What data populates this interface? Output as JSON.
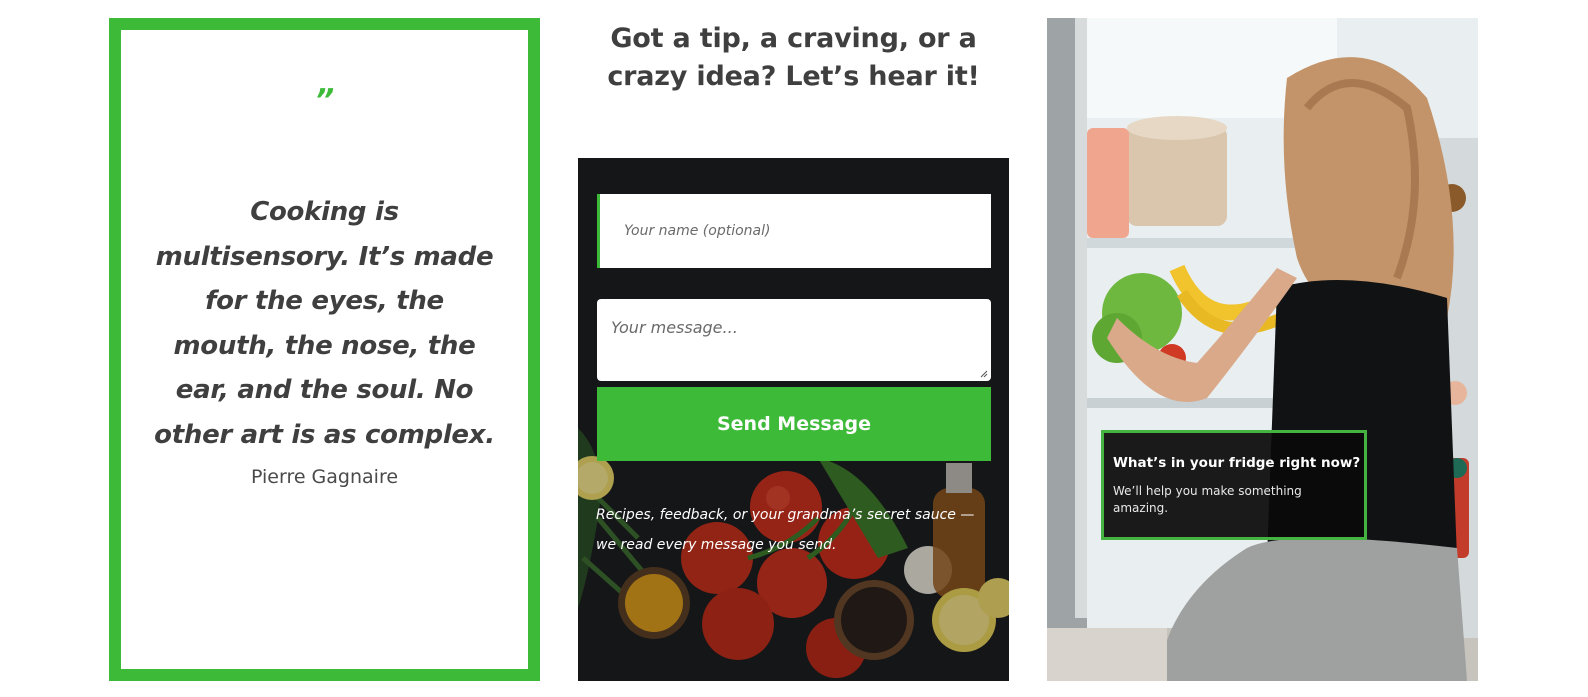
{
  "quote": {
    "mark": "”",
    "text": "Cooking is multisensory. It’s made for the eyes, the mouth, the nose, the ear, and the soul. No other art is as complex.",
    "author": "Pierre Gagnaire"
  },
  "contact": {
    "heading": "Got a tip, a craving, or a crazy idea? Let’s hear it!",
    "name_placeholder": "Your name (optional)",
    "message_placeholder": "Your message...",
    "submit_label": "Send Message",
    "note": "Recipes, feedback, or your grandma’s secret sauce — we read every message you send."
  },
  "promo": {
    "title": "What’s in your fridge right now?",
    "text": "We’ll help you make something amazing."
  },
  "colors": {
    "accent_green": "#3dba37",
    "text_dark": "#3f3f3f",
    "panel_dark": "#1d1e20"
  }
}
